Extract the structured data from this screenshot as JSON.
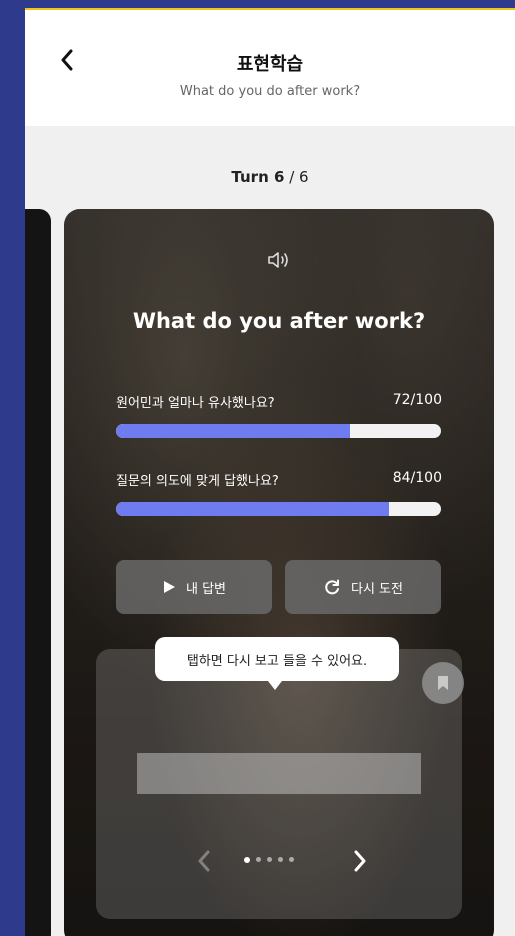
{
  "header": {
    "title": "표현학습",
    "subtitle": "What do you do after work?"
  },
  "turn": {
    "current": "Turn 6",
    "total": " / 6"
  },
  "card": {
    "question": "What do you after work?",
    "metrics": [
      {
        "label": "원어민과 얼마나 유사했나요?",
        "score": "72/100",
        "value": 72,
        "max": 100
      },
      {
        "label": "질문의 의도에 맞게 답했나요?",
        "score": "84/100",
        "value": 84,
        "max": 100
      }
    ],
    "buttons": {
      "my_answer": "내 답변",
      "retry": "다시 도전"
    },
    "tooltip": "탭하면 다시 보고 들을 수 있어요.",
    "pagination": {
      "count": 5,
      "active_index": 0
    }
  },
  "colors": {
    "background": "#2e3a8c",
    "accent_bar": "#6f7cf0",
    "top_accent": "#f2c418"
  },
  "icons": {
    "back": "chevron-left-icon",
    "speaker": "speaker-icon",
    "play": "play-icon",
    "retry": "retry-icon",
    "bookmark": "bookmark-icon",
    "prev": "chevron-left-icon",
    "next": "chevron-right-icon"
  }
}
